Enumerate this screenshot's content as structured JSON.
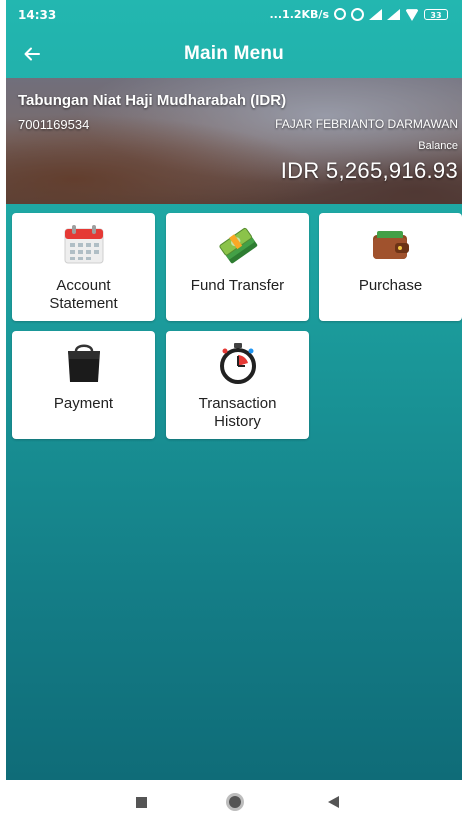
{
  "status_bar": {
    "time": "14:33",
    "network_speed": "...1.2KB/s",
    "battery": "33"
  },
  "app_bar": {
    "title": "Main Menu",
    "back_icon": "arrow-left-icon"
  },
  "account": {
    "name": "Tabungan Niat Haji Mudharabah (IDR)",
    "number": "7001169534",
    "holder": "FAJAR FEBRIANTO DARMAWAN",
    "balance_label": "Balance",
    "balance": "IDR 5,265,916.93"
  },
  "menu": {
    "items": [
      {
        "label": "Account\nStatement",
        "icon": "calendar-icon"
      },
      {
        "label": "Fund Transfer",
        "icon": "money-stack-icon"
      },
      {
        "label": "Purchase",
        "icon": "wallet-icon"
      },
      {
        "label": "Payment",
        "icon": "shopping-bag-icon"
      },
      {
        "label": "Transaction\nHistory",
        "icon": "stopwatch-icon"
      }
    ]
  },
  "colors": {
    "header_teal": "#23b7b0",
    "bottom_teal": "#0f6c78",
    "tile_bg": "#ffffff"
  }
}
